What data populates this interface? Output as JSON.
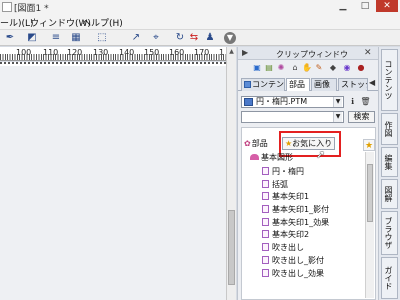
{
  "window": {
    "title": "[図面1 *"
  },
  "menu": {
    "items": [
      "ール)(L)",
      "ウィンドウ(W)",
      "ヘルプ(H)"
    ]
  },
  "toolbar": {
    "icons": [
      "pen-pointer-icon",
      "shape-icon",
      "lines-icon",
      "frame-icon",
      "select-icon",
      "arrow-tool-icon",
      "node-tool-icon",
      "rotate-icon",
      "flip-icon",
      "person-icon",
      "down-circle-icon"
    ]
  },
  "ruler": {
    "labels": [
      "100",
      "110",
      "120",
      "130",
      "140",
      "150",
      "160",
      "170",
      "1"
    ]
  },
  "clip_panel": {
    "title": "クリップウィンドウ",
    "icons": [
      "picture-icon",
      "grid-icon",
      "sparkle-icon",
      "home-icon",
      "hand-icon",
      "paint-icon",
      "bucket-icon",
      "globe-icon",
      "pin-icon"
    ],
    "tabs": [
      "コンテンツ",
      "部品",
      "画像",
      "ストック"
    ],
    "file_combo": "円・楕円.PTM",
    "filter_combo": "",
    "search_label": "検索",
    "tree": {
      "root_label": "部品",
      "favorite_label": "お気に入り",
      "folder_label": "基本図形",
      "items": [
        "円・楕円",
        "括弧",
        "基本矢印1",
        "基本矢印1_影付",
        "基本矢印1_効果",
        "基本矢印2",
        "吹き出し",
        "吹き出し_影付",
        "吹き出し_効果"
      ]
    }
  },
  "side_tabs": [
    "コンテンツ",
    "作図",
    "編集",
    "図解",
    "ブラウザ",
    "ガイド"
  ]
}
